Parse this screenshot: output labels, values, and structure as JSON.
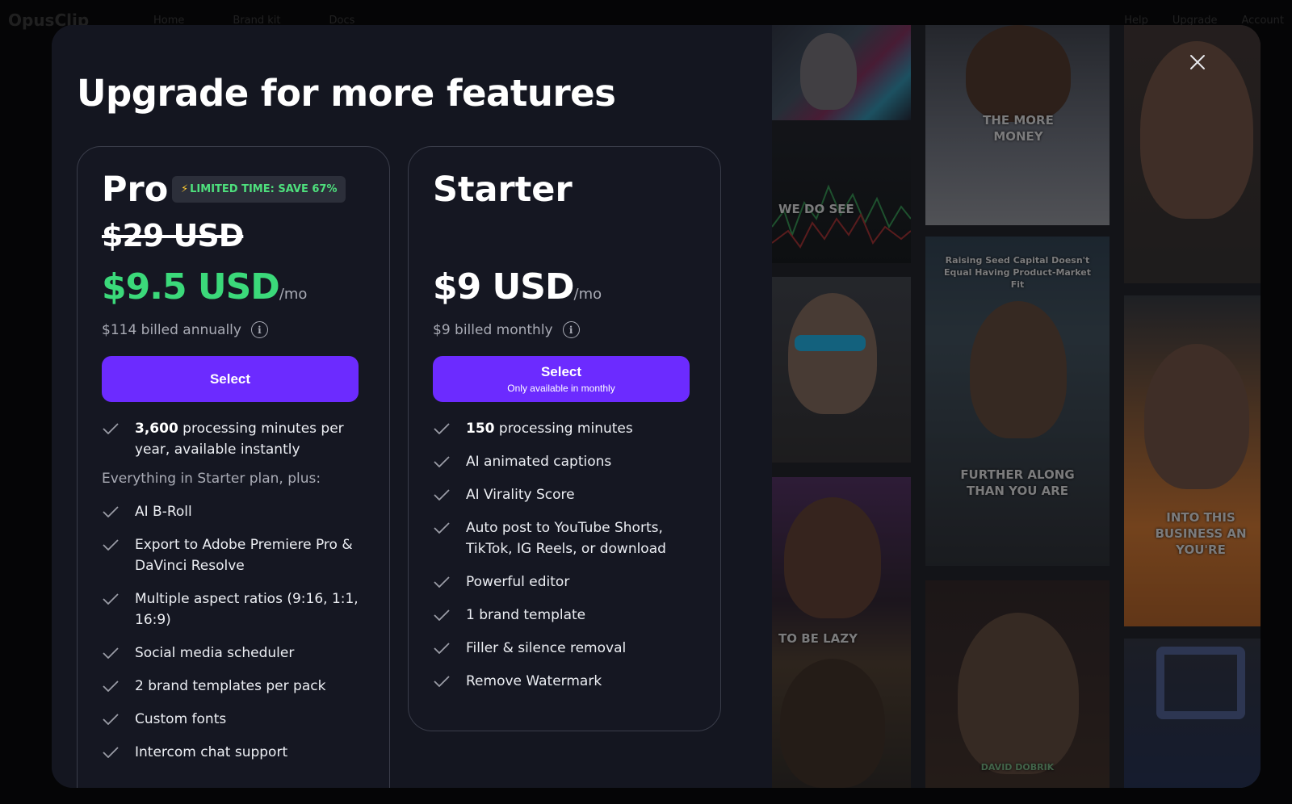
{
  "background": {
    "logo": "OpusClip",
    "nav": [
      "Home",
      "Brand kit",
      "Docs"
    ],
    "right": [
      "Help",
      "Upgrade",
      "Account"
    ]
  },
  "modal": {
    "title": "Upgrade for more features",
    "close_icon": "close-icon"
  },
  "plans": {
    "pro": {
      "name": "Pro",
      "badge": "LIMITED TIME: SAVE 67%",
      "old_price": "$29 USD",
      "price": "$9.5 USD",
      "period": "/mo",
      "billing": "$114 billed annually",
      "button_label": "Select",
      "features_first": {
        "bold": "3,600",
        "text": " processing minutes per year, available instantly"
      },
      "section_note": "Everything in Starter plan, plus:",
      "features": [
        "AI B-Roll",
        "Export to Adobe Premiere Pro & DaVinci Resolve",
        "Multiple aspect ratios (9:16, 1:1, 16:9)",
        "Social media scheduler",
        "2 brand templates per pack",
        "Custom fonts",
        "Intercom chat support"
      ]
    },
    "starter": {
      "name": "Starter",
      "price": "$9 USD",
      "period": "/mo",
      "billing": "$9 billed monthly",
      "button_label": "Select",
      "button_sublabel": "Only available in monthly",
      "features_first": {
        "bold": "150",
        "text": " processing minutes"
      },
      "features": [
        "AI animated captions",
        "AI Virality Score",
        "Auto post to YouTube Shorts, TikTok, IG Reels, or download",
        "Powerful editor",
        "1 brand template",
        "Filler & silence removal",
        "Remove Watermark"
      ]
    }
  },
  "gallery": {
    "captions": {
      "c1": "THE MORE MONEY",
      "c2": "WE DO SEE",
      "c3": "Raising Seed Capital Doesn't Equal Having Product-Market Fit",
      "c4": "FURTHER ALONG THAN YOU ARE",
      "c5": "INTO THIS BUSINESS AN YOU'RE",
      "c6": "TO BE LAZY",
      "c7": "DAVID DOBRIK"
    }
  },
  "colors": {
    "accent": "#6c2bff",
    "promo_green": "#3bd97a",
    "modal_bg": "#141620"
  }
}
